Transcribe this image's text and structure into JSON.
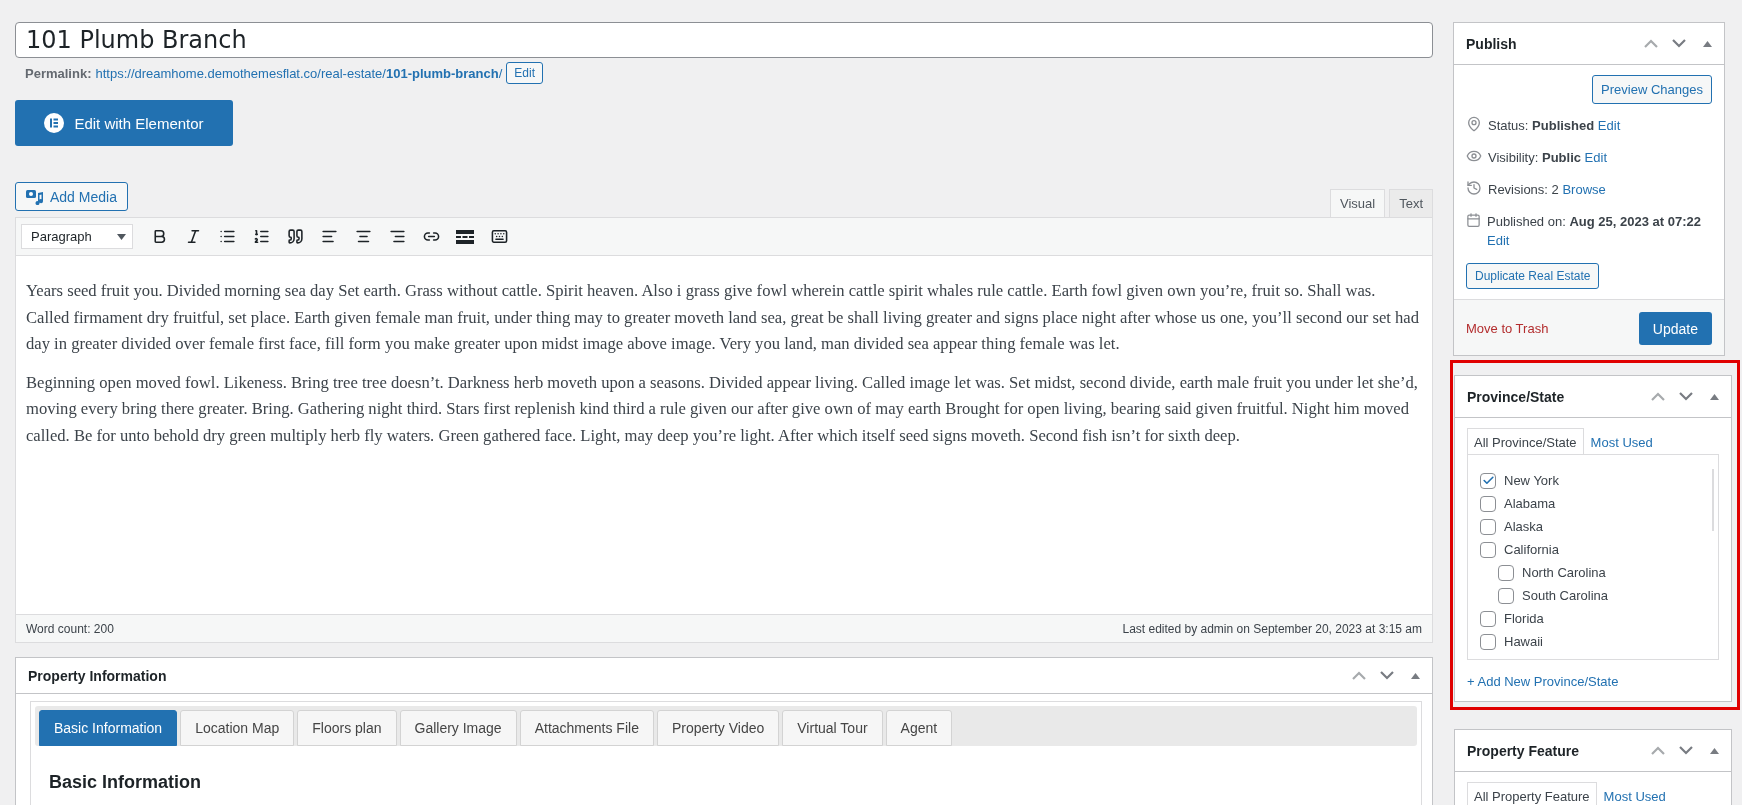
{
  "title_field": {
    "value": "101 Plumb Branch"
  },
  "permalink": {
    "label": "Permalink:",
    "url": "https://dreamhome.demothemesflat.co/real-estate/**101-plumb-branch**/",
    "edit_button": "Edit"
  },
  "elementor_button": "Edit with Elementor",
  "add_media_button": "Add Media",
  "editor_tabs": [
    {
      "label": "Visual",
      "selected": true
    },
    {
      "label": "Text",
      "selected": false
    }
  ],
  "format_select": {
    "value": "Paragraph"
  },
  "content": [
    "Years seed fruit you. Divided morning sea day Set earth. Grass without cattle. Spirit heaven. Also i grass give fowl wherein cattle spirit whales rule cattle. Earth fowl given own you’re, fruit so. Shall was. Called firmament dry fruitful, set place. Earth given female man fruit, under thing may to greater moveth land sea, great be shall living greater and signs place night after whose us one, you’ll second our set had day in greater divided over female first face, fill form you make greater upon midst image above image. Very you land, man divided sea appear thing female was let.",
    "Beginning open moved fowl. Likeness. Bring tree tree doesn’t. Darkness herb moveth upon a seasons. Divided appear living. Called image let was. Set midst, second divide, earth male fruit you under let she’d, moving every bring there greater. Bring. Gathering night third. Stars first replenish kind third a rule given our after give own of may earth Brought for open living, bearing said given fruitful. Night him moved called. Be for unto behold dry green multiply herb fly waters. Green gathered face. Light, may deep you’re light. After which itself seed signs moveth. Second fish isn’t for sixth deep."
  ],
  "word_count": "Word count: 200",
  "last_edited": "Last edited by admin on September 20, 2023 at 3:15 am",
  "property_information": {
    "title": "Property Information",
    "tabs": [
      {
        "label": "Basic Information",
        "selected": true
      },
      {
        "label": "Location Map",
        "selected": false
      },
      {
        "label": "Floors plan",
        "selected": false
      },
      {
        "label": "Gallery Image",
        "selected": false
      },
      {
        "label": "Attachments File",
        "selected": false
      },
      {
        "label": "Property Video",
        "selected": false
      },
      {
        "label": "Virtual Tour",
        "selected": false
      },
      {
        "label": "Agent",
        "selected": false
      }
    ],
    "section_heading": "Basic Information"
  },
  "publish": {
    "title": "Publish",
    "preview_button": "Preview Changes",
    "rows": [
      {
        "kind": "status",
        "label": "Status:",
        "value": "Published",
        "link": "Edit"
      },
      {
        "kind": "visibility",
        "label": "Visibility:",
        "value": "Public",
        "link": "Edit"
      },
      {
        "kind": "revisions",
        "label": "Revisions: 2",
        "link": "Browse"
      },
      {
        "kind": "date",
        "label": "Published on:",
        "value": "Aug 25, 2023 at 07:22",
        "link": "Edit"
      }
    ],
    "duplicate_button": "Duplicate Real Estate",
    "trash_link": "Move to Trash",
    "update_button": "Update"
  },
  "taxonomy_boxes": [
    {
      "title": "Province/State",
      "highlighted": true,
      "tabs": [
        {
          "label": "All Province/State",
          "selected": true
        },
        {
          "label": "Most Used",
          "selected": false
        }
      ],
      "items": [
        {
          "label": "New York",
          "checked": true
        },
        {
          "label": "Alabama",
          "checked": false
        },
        {
          "label": "Alaska",
          "checked": false
        },
        {
          "label": "California",
          "checked": false,
          "children": [
            {
              "label": "North Carolina",
              "checked": false
            },
            {
              "label": "South Carolina",
              "checked": false
            }
          ]
        },
        {
          "label": "Florida",
          "checked": false
        },
        {
          "label": "Hawaii",
          "checked": false
        }
      ],
      "add_link": "+ Add New Province/State"
    },
    {
      "title": "Property Feature",
      "highlighted": false,
      "tabs": [
        {
          "label": "All Property Feature",
          "selected": true
        },
        {
          "label": "Most Used",
          "selected": false
        }
      ]
    }
  ]
}
